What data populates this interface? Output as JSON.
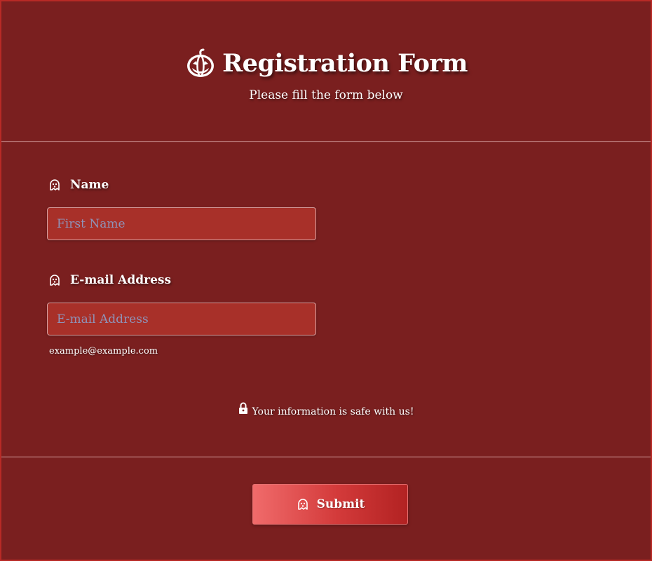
{
  "header": {
    "title": "Registration Form",
    "subtitle": "Please fill the form below",
    "title_icon": "pumpkin-icon"
  },
  "form": {
    "name": {
      "label": "Name",
      "placeholder": "First Name",
      "value": "",
      "icon": "ghost-icon"
    },
    "email": {
      "label": "E-mail Address",
      "placeholder": "E-mail Address",
      "value": "",
      "hint": "example@example.com",
      "icon": "ghost-icon"
    },
    "safe_note": "Your information is safe with us!",
    "safe_icon": "lock-icon"
  },
  "submit": {
    "label": "Submit",
    "icon": "ghost-icon"
  },
  "colors": {
    "background": "#7a1f1f",
    "input_bg": "#a83029",
    "button_start": "#f06b6b",
    "button_end": "#b22222",
    "placeholder": "#8f93b8"
  }
}
